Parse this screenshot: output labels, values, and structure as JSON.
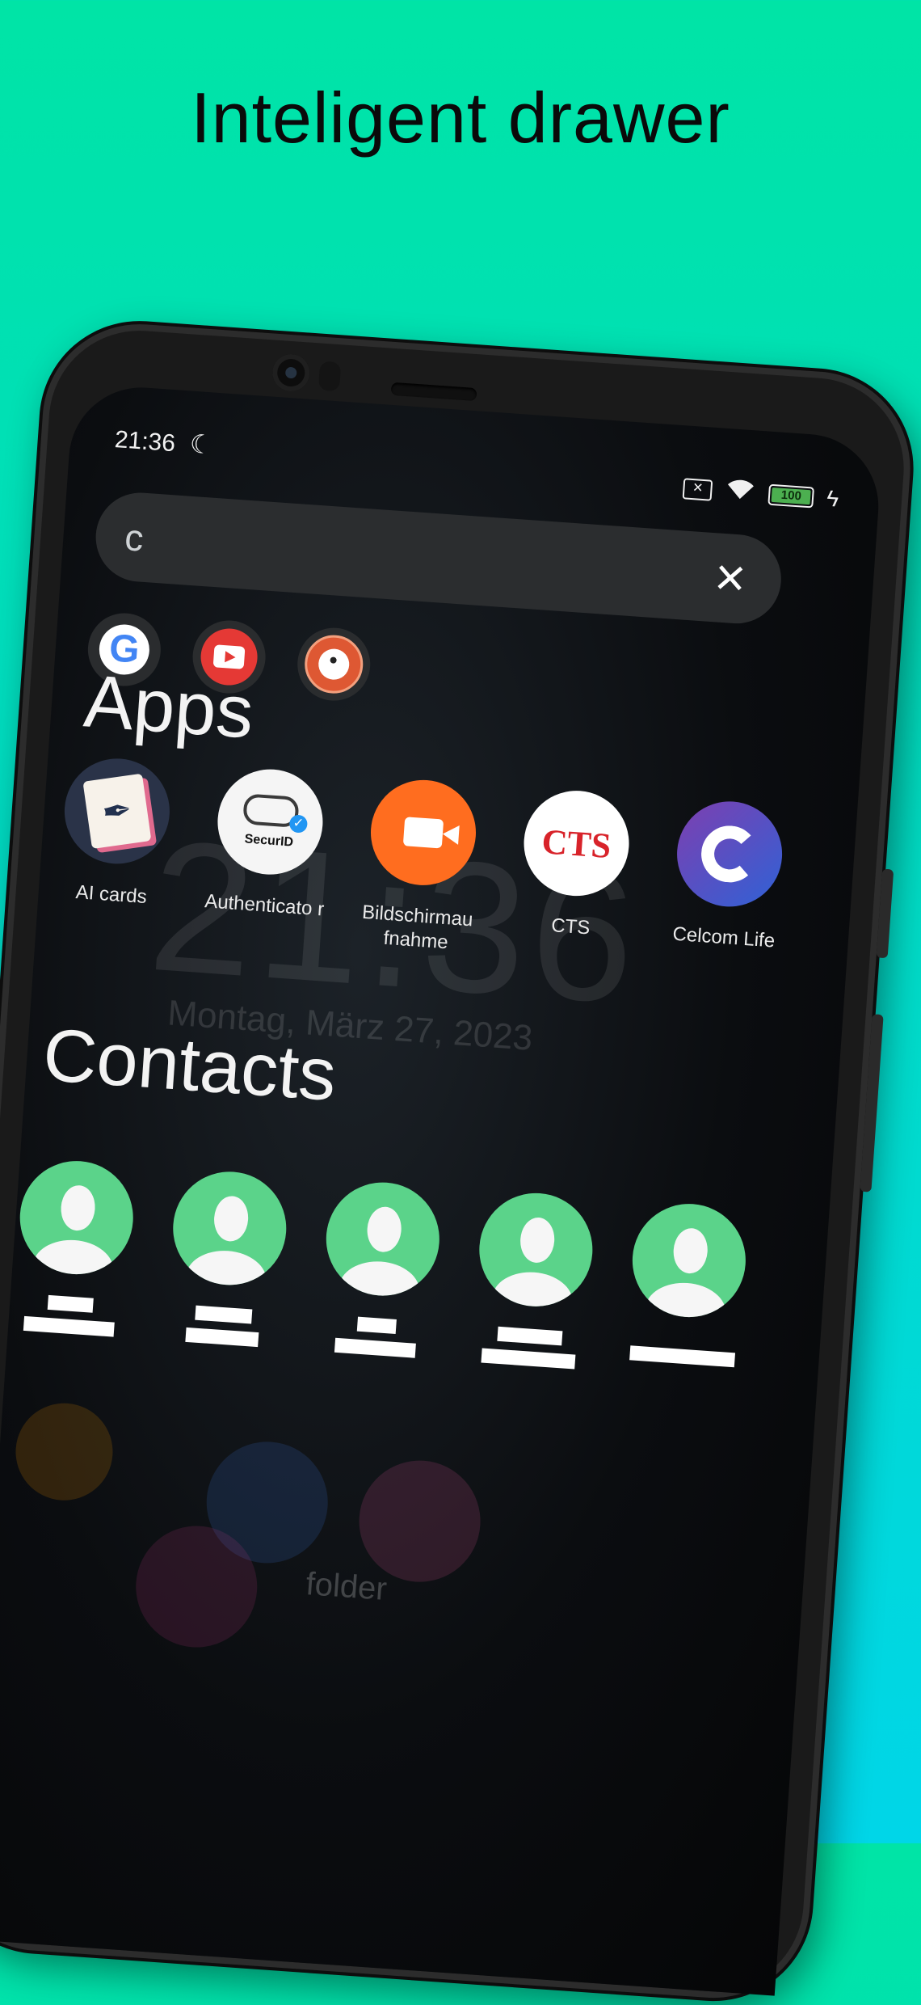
{
  "headline": "Inteligent drawer",
  "status": {
    "time": "21:36",
    "battery": "100"
  },
  "search": {
    "value": "c",
    "clear_icon": "close-icon"
  },
  "search_engines": [
    {
      "name": "google-icon"
    },
    {
      "name": "youtube-icon"
    },
    {
      "name": "duckduckgo-icon"
    }
  ],
  "apps_section": {
    "title": "Apps",
    "items": [
      {
        "label": "AI cards"
      },
      {
        "label": "Authenticato r"
      },
      {
        "label": "Bildschirmau fnahme"
      },
      {
        "label": "CTS",
        "icon_text": "CTS"
      },
      {
        "label": "Celcom Life"
      }
    ]
  },
  "contacts_section": {
    "title": "Contacts",
    "count": 5
  },
  "wallpaper": {
    "clock": "21:36",
    "date": "Montag, März 27, 2023",
    "folder": "folder"
  },
  "colors": {
    "background_top": "#00e4a6",
    "background_bottom": "#00d6e8",
    "avatar": "#5bd38a",
    "search_bar": "#2b2d2f"
  }
}
